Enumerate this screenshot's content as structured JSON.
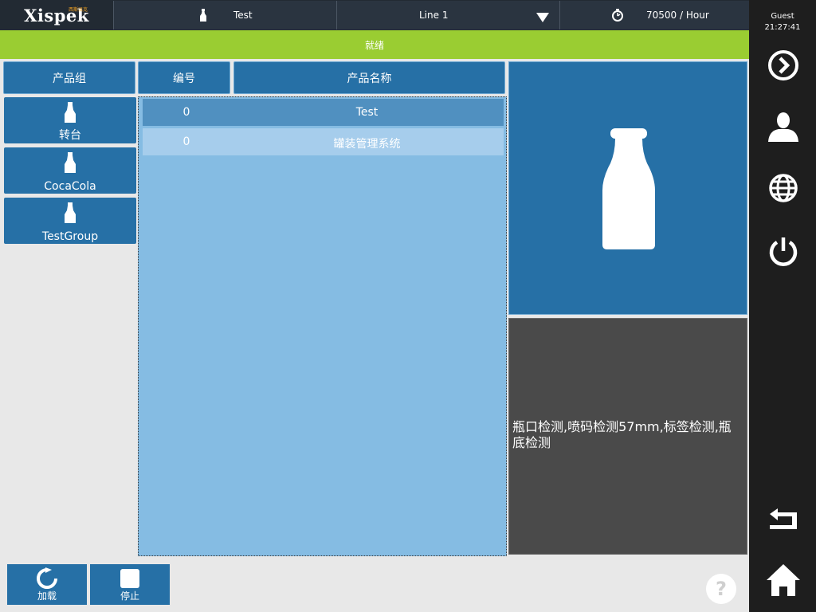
{
  "header": {
    "logo": "Xispek",
    "logo_sub": "西斯派克",
    "product": "Test",
    "line": "Line 1",
    "rate": "70500 / Hour"
  },
  "sidebar": {
    "user": "Guest",
    "time": "21:27:41"
  },
  "status": "就绪",
  "columns": {
    "group": "产品组",
    "id": "编号",
    "name": "产品名称"
  },
  "groups": [
    {
      "label": "转台"
    },
    {
      "label": "CocaCola"
    },
    {
      "label": "TestGroup"
    }
  ],
  "products": [
    {
      "id": "0",
      "name": "Test"
    },
    {
      "id": "0",
      "name": "罐装管理系统"
    }
  ],
  "description": "瓶口检测,喷码检测57mm,标签检测,瓶底检测",
  "buttons": {
    "load": "加载",
    "stop": "停止"
  },
  "help": "?",
  "colors": {
    "status_green": "#9acd32",
    "accent_blue": "#2670a6",
    "list_blue": "#85bce3",
    "selected_row": "#5090c0",
    "row_light": "#a6cdec"
  }
}
